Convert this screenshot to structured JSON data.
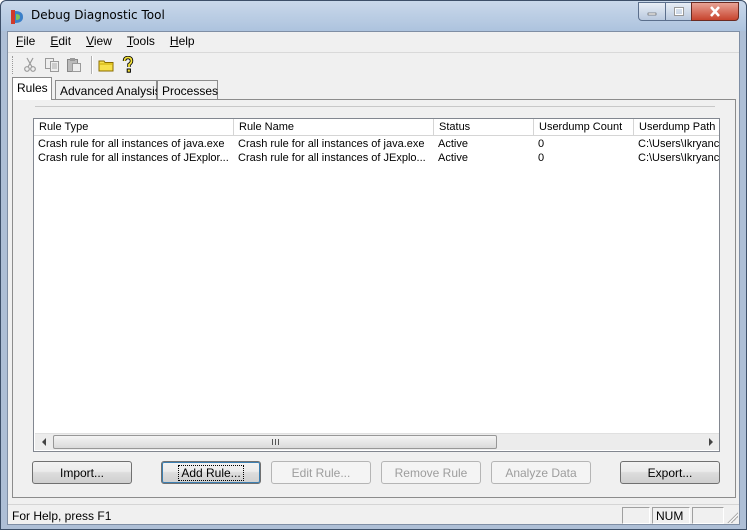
{
  "window": {
    "title": "Debug Diagnostic Tool",
    "accent_color": "#c7442e"
  },
  "menu": {
    "items": [
      {
        "label": "File",
        "mnemonic": "F",
        "rest": "ile"
      },
      {
        "label": "Edit",
        "mnemonic": "E",
        "rest": "dit"
      },
      {
        "label": "View",
        "mnemonic": "V",
        "rest": "iew"
      },
      {
        "label": "Tools",
        "mnemonic": "T",
        "rest": "ools"
      },
      {
        "label": "Help",
        "mnemonic": "H",
        "rest": "elp"
      }
    ]
  },
  "toolbar": {
    "icons": [
      "cut-icon",
      "copy-icon",
      "paste-icon",
      "open-folder-icon",
      "help-icon"
    ]
  },
  "tabs": [
    {
      "label": "Rules",
      "active": true
    },
    {
      "label": "Advanced Analysis",
      "active": false
    },
    {
      "label": "Processes",
      "active": false
    }
  ],
  "rules_list": {
    "columns": [
      "Rule Type",
      "Rule Name",
      "Status",
      "Userdump Count",
      "Userdump Path"
    ],
    "rows": [
      [
        "Crash rule for all instances of java.exe",
        "Crash rule for all instances of java.exe",
        "Active",
        "0",
        "C:\\Users\\Ikryanc"
      ],
      [
        "Crash rule for all instances of JExplor...",
        "Crash rule for all instances of JExplo...",
        "Active",
        "0",
        "C:\\Users\\Ikryanc"
      ]
    ],
    "scrollbar_grip": "III"
  },
  "buttons": {
    "import": "Import...",
    "add_rule": "Add Rule...",
    "edit_rule": "Edit Rule...",
    "remove_rule": "Remove Rule",
    "analyze_data": "Analyze Data",
    "export": "Export..."
  },
  "status": {
    "text": "For Help, press F1",
    "num": "NUM"
  }
}
